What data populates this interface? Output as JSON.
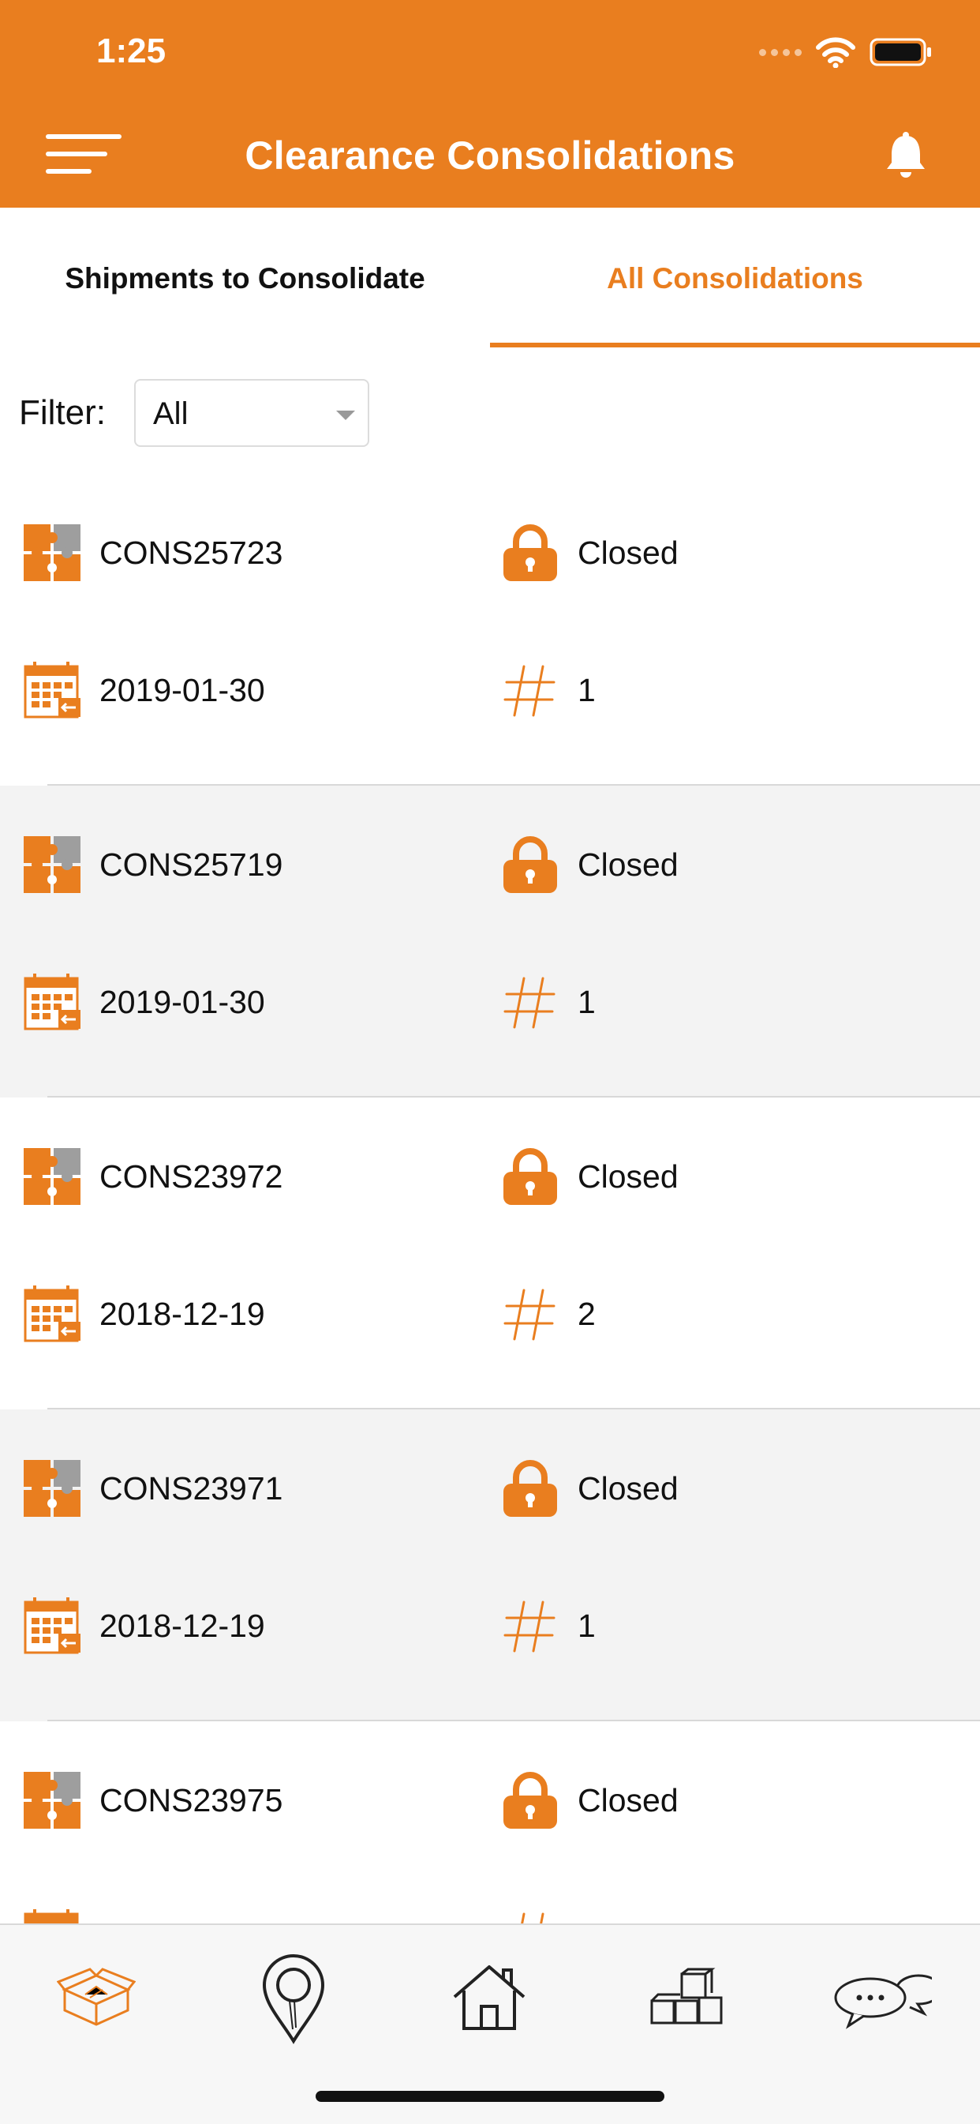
{
  "status_bar": {
    "time": "1:25"
  },
  "header": {
    "title": "Clearance Consolidations"
  },
  "tabs": [
    {
      "label": "Shipments to Consolidate",
      "active": false
    },
    {
      "label": "All Consolidations",
      "active": true
    }
  ],
  "filter": {
    "label": "Filter:",
    "selected": "All"
  },
  "consolidations": [
    {
      "id": "CONS25723",
      "status": "Closed",
      "date": "2019-01-30",
      "count": "1"
    },
    {
      "id": "CONS25719",
      "status": "Closed",
      "date": "2019-01-30",
      "count": "1"
    },
    {
      "id": "CONS23972",
      "status": "Closed",
      "date": "2018-12-19",
      "count": "2"
    },
    {
      "id": "CONS23971",
      "status": "Closed",
      "date": "2018-12-19",
      "count": "1"
    },
    {
      "id": "CONS23975",
      "status": "Closed",
      "date": "",
      "count": ""
    }
  ],
  "bottom_nav": [
    {
      "icon": "open-box-icon",
      "active": true
    },
    {
      "icon": "map-pin-icon",
      "active": false
    },
    {
      "icon": "home-icon",
      "active": false
    },
    {
      "icon": "boxes-icon",
      "active": false
    },
    {
      "icon": "chat-bubbles-icon",
      "active": false
    }
  ],
  "colors": {
    "accent": "#E97E1F",
    "row_alt": "#f3f3f3",
    "puzzle_gray": "#9e9e9e"
  }
}
